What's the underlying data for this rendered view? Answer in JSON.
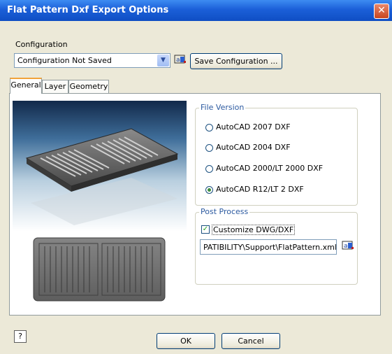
{
  "window": {
    "title": "Flat Pattern Dxf Export Options",
    "close_glyph": "✕"
  },
  "configuration": {
    "label": "Configuration",
    "selected": "Configuration Not Saved",
    "save_button": "Save Configuration ..."
  },
  "tabs": [
    {
      "label": "General",
      "active": true
    },
    {
      "label": "Layer",
      "active": false
    },
    {
      "label": "Geometry",
      "active": false
    }
  ],
  "file_version": {
    "title": "File Version",
    "options": [
      {
        "label": "AutoCAD 2007 DXF",
        "selected": false
      },
      {
        "label": "AutoCAD 2004 DXF",
        "selected": false
      },
      {
        "label": "AutoCAD 2000/LT 2000 DXF",
        "selected": false
      },
      {
        "label": "AutoCAD R12/LT 2 DXF",
        "selected": true
      }
    ]
  },
  "post_process": {
    "title": "Post Process",
    "checkbox_label": "Customize DWG/DXF",
    "checked": true,
    "path_value": "PATIBILITY\\Support\\FlatPattern.xml"
  },
  "footer": {
    "help_glyph": "?",
    "ok_label": "OK",
    "cancel_label": "Cancel"
  },
  "icons": {
    "config_browse": "folder-browse-icon",
    "path_browse": "folder-browse-icon",
    "help": "help-icon"
  },
  "colors": {
    "titlebar": "#1b5fd8",
    "dialog_bg": "#ece9d8",
    "group_title": "#2c5aa0",
    "active_tab_accent": "#f2a33a"
  }
}
